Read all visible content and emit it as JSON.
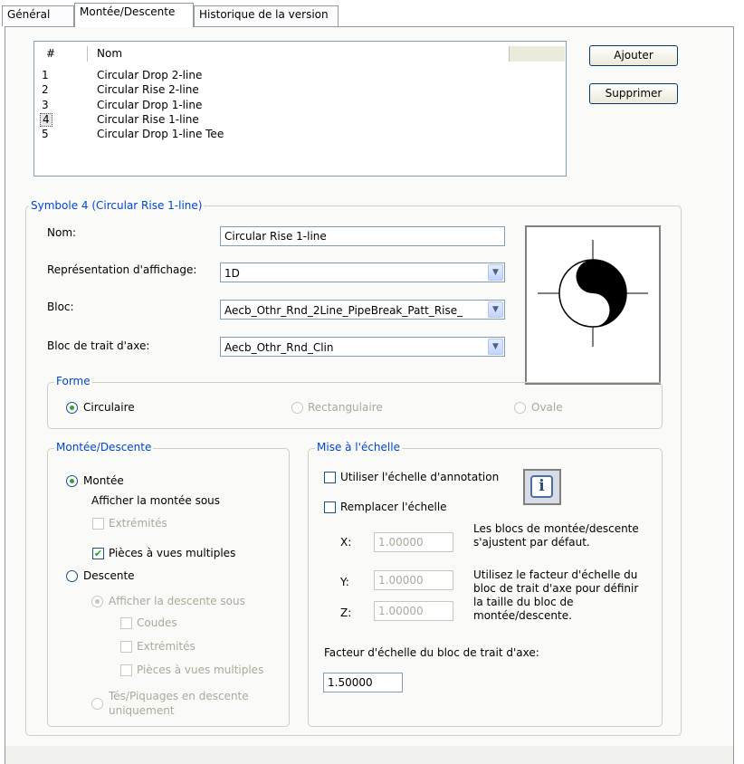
{
  "tabs": [
    "Général",
    "Montée/Descente",
    "Historique de la version"
  ],
  "list": {
    "headers": [
      "#",
      "Nom"
    ],
    "rows": [
      {
        "num": "1",
        "name": "Circular Drop 2-line"
      },
      {
        "num": "2",
        "name": "Circular Rise 2-line"
      },
      {
        "num": "3",
        "name": "Circular Drop 1-line"
      },
      {
        "num": "4",
        "name": "Circular Rise 1-line"
      },
      {
        "num": "5",
        "name": "Circular Drop 1-line Tee"
      }
    ]
  },
  "buttons": {
    "add": "Ajouter",
    "remove": "Supprimer"
  },
  "symbol": {
    "legend": "Symbole 4 (Circular Rise 1-line)",
    "name_label": "Nom:",
    "name_value": "Circular Rise 1-line",
    "display_label": "Représentation d'affichage:",
    "display_value": "1D",
    "block_label": "Bloc:",
    "block_value": "Aecb_Othr_Rnd_2Line_PipeBreak_Patt_Rise_",
    "axis_block_label": "Bloc de trait d'axe:",
    "axis_block_value": "Aecb_Othr_Rnd_Clin"
  },
  "forme": {
    "legend": "Forme",
    "circular": "Circulaire",
    "rectangular": "Rectangulaire",
    "oval": "Ovale"
  },
  "rise_drop": {
    "legend": "Montée/Descente",
    "rise": "Montée",
    "show_rise_under": "Afficher la montée sous",
    "ends": "Extrémités",
    "multiview_parts": "Pièces à vues multiples",
    "drop": "Descente",
    "show_drop_under": "Afficher la descente sous",
    "elbows": "Coudes",
    "ends2": "Extrémités",
    "multiview_parts2": "Pièces à vues multiples",
    "tees_line1": "Tés/Piquages en descente",
    "tees_line2": "uniquement"
  },
  "scale": {
    "legend": "Mise à l'échelle",
    "use_annotation": "Utiliser l'échelle d'annotation",
    "override": "Remplacer l'échelle",
    "x_label": "X:",
    "x_value": "1.00000",
    "y_label": "Y:",
    "y_value": "1.00000",
    "z_label": "Z:",
    "z_value": "1.00000",
    "info1_line1": "Les blocs de montée/descente",
    "info1_line2": "s'ajustent par défaut.",
    "info2_line1": "Utilisez le facteur d'échelle du",
    "info2_line2": "bloc de trait d'axe pour définir",
    "info2_line3": "la taille du bloc de",
    "info2_line4": "montée/descente.",
    "factor_label": "Facteur d'échelle du bloc de trait d'axe:",
    "factor_value": "1.50000",
    "info_icon": "info-icon"
  },
  "colors": {
    "legend_text": "#0046d5",
    "check_green": "#21a121"
  }
}
